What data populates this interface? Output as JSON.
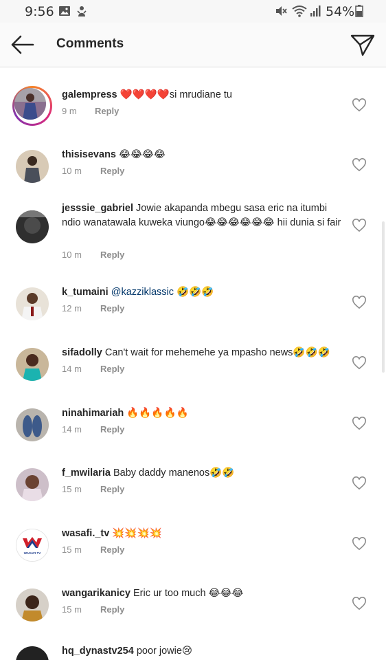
{
  "status_bar": {
    "time": "9:56",
    "battery_percent": "54%",
    "icons": [
      "image-icon",
      "notification-icon",
      "mute-icon",
      "wifi-icon",
      "signal-icon",
      "battery-icon"
    ]
  },
  "header": {
    "title": "Comments",
    "back_icon": "arrow-left-icon",
    "send_icon": "paper-plane-icon"
  },
  "comments": [
    {
      "username": "galempress",
      "text": "❤️❤️❤️❤️si mrudiane tu",
      "time": "9 m",
      "reply": "Reply"
    },
    {
      "username": "thisisevans",
      "text": "😂😂😂😂",
      "time": "10 m",
      "reply": "Reply"
    },
    {
      "username": "jesssie_gabriel",
      "text": "Jowie akapanda mbegu sasa eric na itumbi ndio wanatawala kuweka viungo😂😂😂😂😂😂 hii dunia si fair",
      "time": "10 m",
      "reply": "Reply"
    },
    {
      "username": "k_tumaini",
      "mention": "@kazziklassic",
      "text": " 🤣🤣🤣",
      "time": "12 m",
      "reply": "Reply"
    },
    {
      "username": "sifadolly",
      "text": "Can't wait for mehemehe ya mpasho news🤣🤣🤣",
      "time": "14 m",
      "reply": "Reply"
    },
    {
      "username": "ninahimariah",
      "text": "🔥🔥🔥🔥🔥",
      "time": "14 m",
      "reply": "Reply"
    },
    {
      "username": "f_mwilaria",
      "text": "Baby daddy manenos🤣🤣",
      "time": "15 m",
      "reply": "Reply"
    },
    {
      "username": "wasafi._tv",
      "text": "💥💥💥💥",
      "time": "15 m",
      "reply": "Reply"
    },
    {
      "username": "wangarikanicy",
      "text": "Eric ur too much 😂😂😂",
      "time": "15 m",
      "reply": "Reply"
    }
  ],
  "partial_comment": {
    "username": "hq_dynastv254",
    "text": "poor jowie😢"
  },
  "wasafi_logo_text": "WASAFI TV",
  "colors": {
    "accent_link": "#003569",
    "muted": "#8e8e8e",
    "heart_red": "#ed4956"
  }
}
